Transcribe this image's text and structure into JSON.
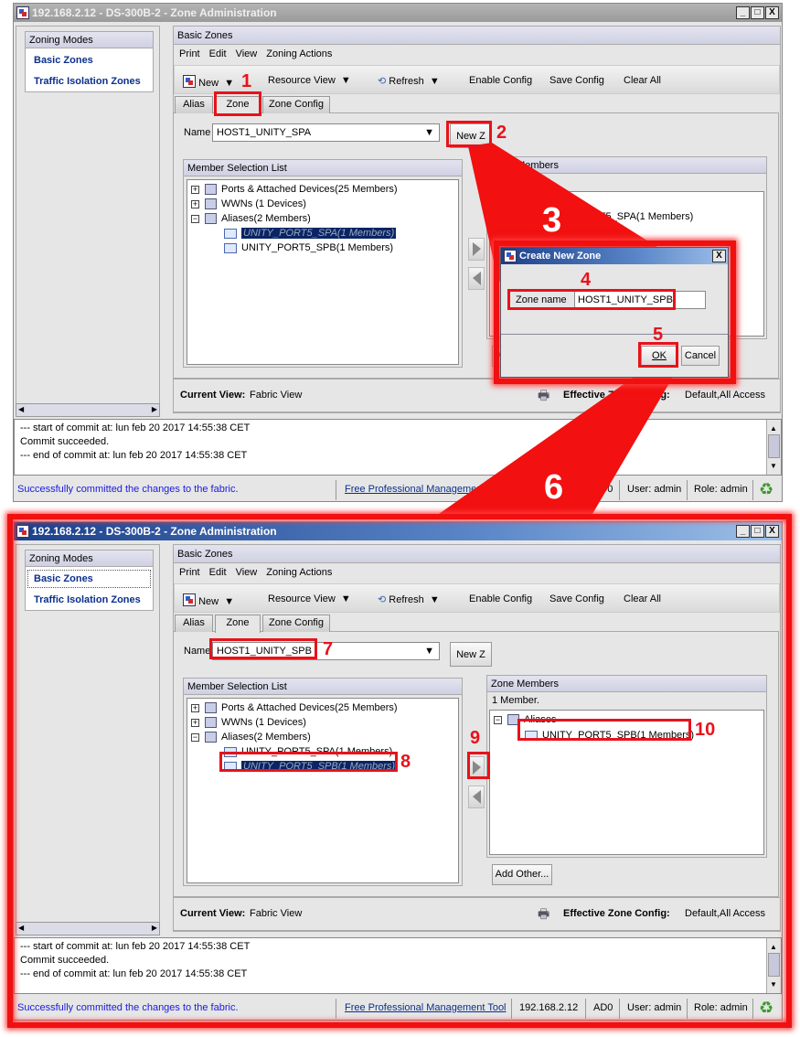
{
  "app": {
    "zoning_modes_header": "Zoning Modes",
    "zoning_modes": [
      "Basic Zones",
      "Traffic Isolation Zones"
    ],
    "panel_title": "Basic Zones",
    "menu": [
      "Print",
      "Edit",
      "View",
      "Zoning Actions"
    ],
    "toolbar": {
      "new": "New",
      "resource_view": "Resource View",
      "refresh": "Refresh",
      "enable_config": "Enable Config",
      "save_config": "Save Config",
      "clear_all": "Clear All"
    },
    "tabs": [
      "Alias",
      "Zone",
      "Zone Config"
    ],
    "name_label": "Name",
    "new_zone_button": "New Z",
    "member_selection_header": "Member Selection List",
    "zone_members_header": "Zone Members",
    "tree": {
      "ports": "Ports & Attached Devices(25 Members)",
      "wwns": "WWNs (1 Devices)",
      "aliases": "Aliases(2 Members)",
      "alias_items": [
        "UNITY_PORT5_SPA(1 Members)",
        "UNITY_PORT5_SPB(1 Members)"
      ]
    },
    "current_view_label": "Current View:",
    "current_view_value": "Fabric View",
    "effective_config_label": "Effective Zone Config:",
    "effective_config_value": "Default,All Access",
    "log_lines": [
      "--- start of commit at: lun feb 20 2017 14:55:38 CET",
      "Commit succeeded.",
      "--- end of commit at: lun feb 20 2017 14:55:38 CET"
    ],
    "status": {
      "message": "Successfully committed the changes to the fabric.",
      "link": "Free Professional Management Tool",
      "ip": "192.168.2.12",
      "ad": "AD0",
      "user": "User: admin",
      "role": "Role: admin"
    },
    "add_other": "Add Other..."
  },
  "windows": [
    {
      "title": "192.168.2.12 - DS-300B-2 - Zone Administration",
      "active": false,
      "name_value": "HOST1_UNITY_SPA",
      "selected_alias": 0,
      "zone_members_count": "",
      "zone_members_group": "Aliases",
      "zone_member": "UNITY_PORT5_SPA(1 Members)"
    },
    {
      "title": "192.168.2.12 - DS-300B-2 - Zone Administration",
      "active": true,
      "name_value": "HOST1_UNITY_SPB",
      "selected_alias": 1,
      "zone_members_count": "1 Member.",
      "zone_members_group": "Aliases",
      "zone_member": "UNITY_PORT5_SPB(1 Members)"
    }
  ],
  "dialog": {
    "title": "Create New Zone",
    "zone_name_label": "Zone name",
    "zone_name_value": "HOST1_UNITY_SPB",
    "ok": "OK",
    "cancel": "Cancel",
    "close": "X"
  },
  "annotations": [
    "1",
    "2",
    "3",
    "4",
    "5",
    "6",
    "7",
    "8",
    "9",
    "10"
  ],
  "colors": {
    "annotation_red": "#e8121a",
    "selection_blue": "#0a2466",
    "link_blue": "#0b2f8c"
  }
}
